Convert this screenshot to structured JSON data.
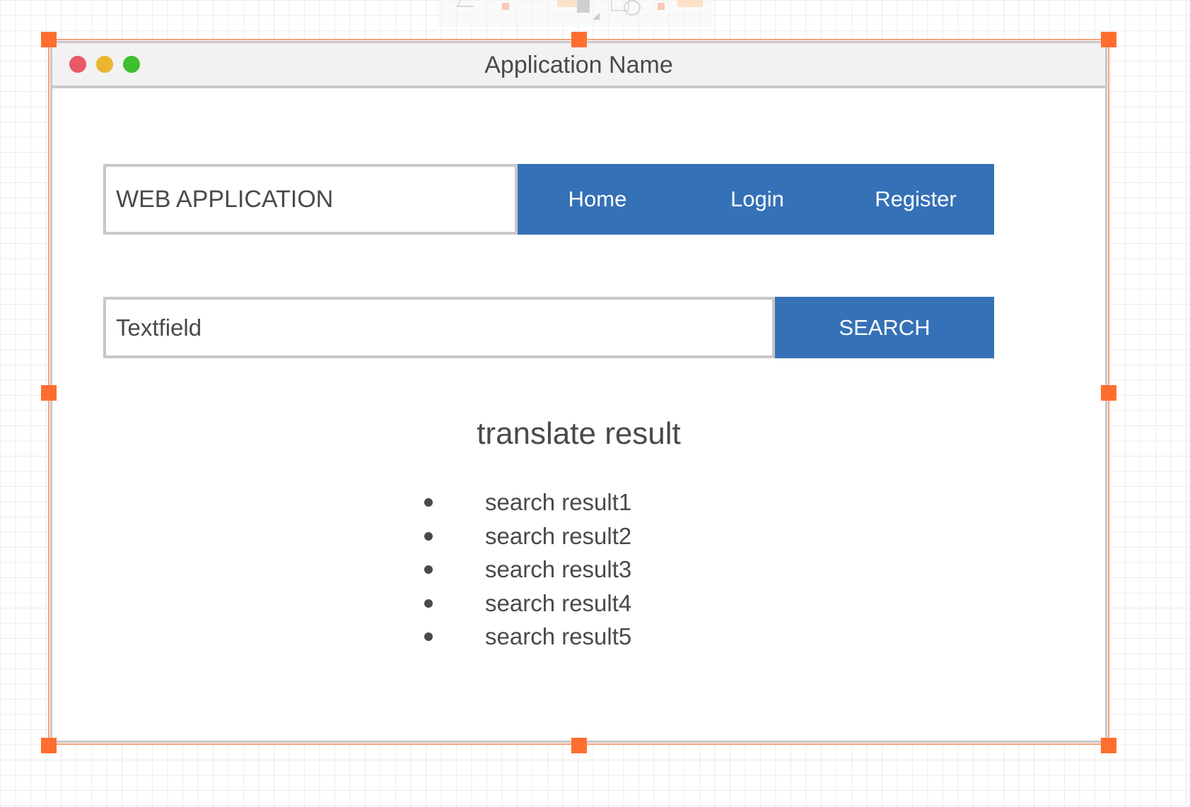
{
  "window": {
    "title": "Application Name"
  },
  "header": {
    "app_name": "WEB APPLICATION",
    "nav": {
      "home": "Home",
      "login": "Login",
      "register": "Register"
    }
  },
  "search": {
    "placeholder": "Textfield",
    "button_label": "SEARCH"
  },
  "results": {
    "title": "translate result",
    "items": [
      "search result1",
      "search result2",
      "search result3",
      "search result4",
      "search result5"
    ]
  },
  "colors": {
    "accent": "#3571b6",
    "selection": "#ff6e2e",
    "traffic_close": "#e8596a",
    "traffic_minimize": "#eab62f",
    "traffic_maximize": "#3dbf2e"
  }
}
